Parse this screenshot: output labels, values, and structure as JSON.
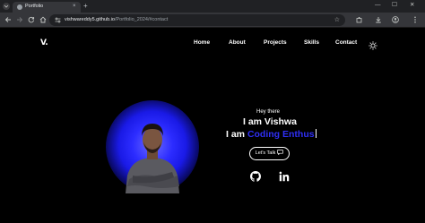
{
  "browser": {
    "tab_title": "Portfolio",
    "tab_close": "×",
    "new_tab": "+",
    "minimize": "—",
    "maximize": "☐",
    "close": "✕",
    "url_host": "vishwareddy5.github.io",
    "url_path": "/Portfolio_2024/#contact",
    "icons": [
      "search-tabs-icon",
      "back-icon",
      "forward-icon",
      "reload-icon",
      "home-icon",
      "site-info-icon",
      "star-icon",
      "extensions-icon",
      "download-icon",
      "profile-icon",
      "menu-icon"
    ]
  },
  "site": {
    "logo": "V.",
    "nav": [
      "Home",
      "About",
      "Projects",
      "Skills",
      "Contact"
    ],
    "theme_icon": "sun-icon"
  },
  "hero": {
    "greeting": "Hey there",
    "name": "I am Vishwa",
    "typed_prefix": "I am ",
    "typed_word": "Coding Enthus",
    "cta": "Let's Talk",
    "accent_color": "#2f2ff5",
    "social": [
      "github-icon",
      "linkedin-icon"
    ]
  }
}
